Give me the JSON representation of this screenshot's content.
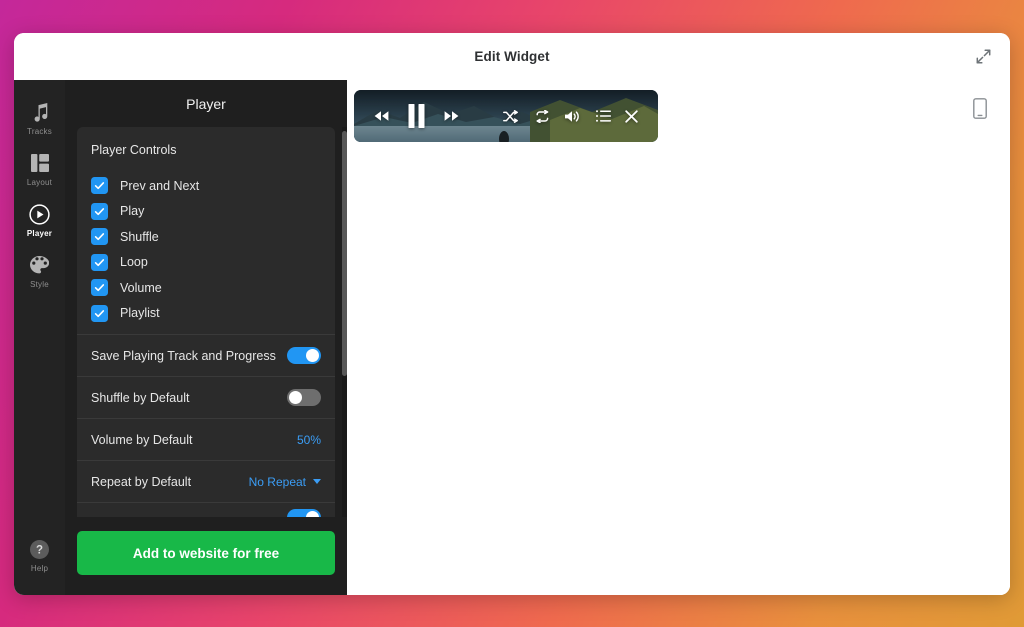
{
  "header": {
    "title": "Edit Widget",
    "expand_icon": "expand-arrows-icon"
  },
  "rail": {
    "items": [
      {
        "label": "Tracks",
        "icon": "music-note-icon",
        "active": false
      },
      {
        "label": "Layout",
        "icon": "layout-grid-icon",
        "active": false
      },
      {
        "label": "Player",
        "icon": "play-circle-icon",
        "active": true
      },
      {
        "label": "Style",
        "icon": "palette-icon",
        "active": false
      }
    ],
    "help": {
      "label": "Help",
      "icon": "question-circle-icon"
    }
  },
  "panel": {
    "title": "Player",
    "controls_heading": "Player Controls",
    "controls": [
      {
        "label": "Prev and Next",
        "checked": true
      },
      {
        "label": "Play",
        "checked": true
      },
      {
        "label": "Shuffle",
        "checked": true
      },
      {
        "label": "Loop",
        "checked": true
      },
      {
        "label": "Volume",
        "checked": true
      },
      {
        "label": "Playlist",
        "checked": true
      }
    ],
    "settings": [
      {
        "label": "Save Playing Track and Progress",
        "type": "toggle",
        "value": "on"
      },
      {
        "label": "Shuffle by Default",
        "type": "toggle",
        "value": "off"
      },
      {
        "label": "Volume by Default",
        "type": "value",
        "value": "50%"
      },
      {
        "label": "Repeat by Default",
        "type": "select",
        "value": "No Repeat"
      }
    ],
    "cta_label": "Add to website for free",
    "accent_blue": "#2196f3",
    "cta_green": "#18b848"
  },
  "preview": {
    "device_icon": "mobile-device-icon",
    "widget": {
      "controls": [
        {
          "name": "rewind",
          "icon": "rewind-icon"
        },
        {
          "name": "pause",
          "icon": "pause-icon"
        },
        {
          "name": "forward",
          "icon": "fast-forward-icon"
        },
        {
          "name": "shuffle",
          "icon": "shuffle-icon"
        },
        {
          "name": "repeat",
          "icon": "repeat-icon"
        },
        {
          "name": "volume",
          "icon": "volume-icon"
        },
        {
          "name": "playlist",
          "icon": "playlist-icon"
        },
        {
          "name": "close",
          "icon": "close-icon"
        }
      ]
    }
  }
}
